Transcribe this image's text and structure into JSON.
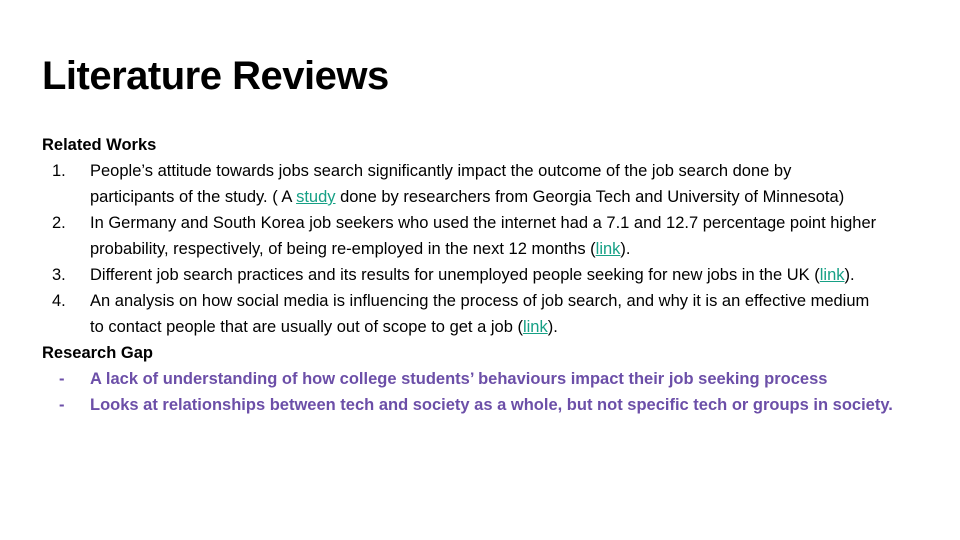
{
  "title": "Literature Reviews",
  "related_works": {
    "heading": "Related Works",
    "items": [
      {
        "num": "1.",
        "line1": "People’s attitude towards jobs search significantly impact the outcome of the job search done by",
        "line2_before": "participants of the study. ( A ",
        "link": "study",
        "line2_after": " done by researchers from Georgia Tech and University of Minnesota)"
      },
      {
        "num": "2.",
        "line1": "In Germany and South Korea job seekers who used the internet had a 7.1 and 12.7 percentage point higher",
        "line2_before": "probability, respectively, of being re-employed in the next 12 months (",
        "link": "link",
        "line2_after": ")."
      },
      {
        "num": "3.",
        "line1_before": "Different job search practices and its results for unemployed people seeking for new jobs in the UK (",
        "link": "link",
        "line1_after": ")."
      },
      {
        "num": "4.",
        "line1": "An analysis on how social media is influencing the process of job search, and why it is an effective medium",
        "line2_before": "to contact people that are usually out of scope to get a job (",
        "link": "link",
        "line2_after": ")."
      }
    ]
  },
  "research_gap": {
    "heading": "Research Gap",
    "bullet": "-",
    "items": [
      "A lack of understanding of how college students’ behaviours impact their job seeking process",
      "Looks at relationships between tech and society as a whole, but not specific tech or groups in society."
    ]
  },
  "colors": {
    "link": "#16a085",
    "gap_text": "#6c4fa8"
  }
}
